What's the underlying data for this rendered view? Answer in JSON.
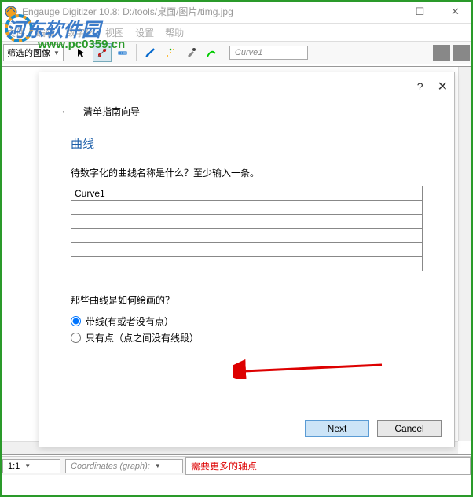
{
  "titlebar": {
    "text": "Engauge Digitizer 10.8: D:/tools/桌面/图片/timg.jpg"
  },
  "win_controls": {
    "min": "—",
    "max": "☐",
    "close": "✕"
  },
  "menubar": [
    "文件",
    "编辑",
    "数字化",
    "视图",
    "设置",
    "帮助"
  ],
  "watermark": {
    "main": "河东软件园",
    "sub": "www.pc0359.cn"
  },
  "toolbar": {
    "filter_label": "筛选的图像",
    "curve_field": "Curve1"
  },
  "dialog": {
    "help_icon": "?",
    "close_icon": "✕",
    "back_icon": "←",
    "header": "清单指南向导",
    "section": "曲线",
    "prompt": "待数字化的曲线名称是什么？至少输入一条。",
    "rows": [
      "Curve1",
      "",
      "",
      "",
      "",
      ""
    ],
    "radio_prompt": "那些曲线是如何绘画的？",
    "radio1": "带线(有或者没有点）",
    "radio2": "只有点（点之间没有线段）",
    "next": "Next",
    "cancel": "Cancel"
  },
  "statusbar": {
    "zoom": "1:1",
    "coords": "Coordinates (graph):",
    "message": "需要更多的轴点"
  }
}
